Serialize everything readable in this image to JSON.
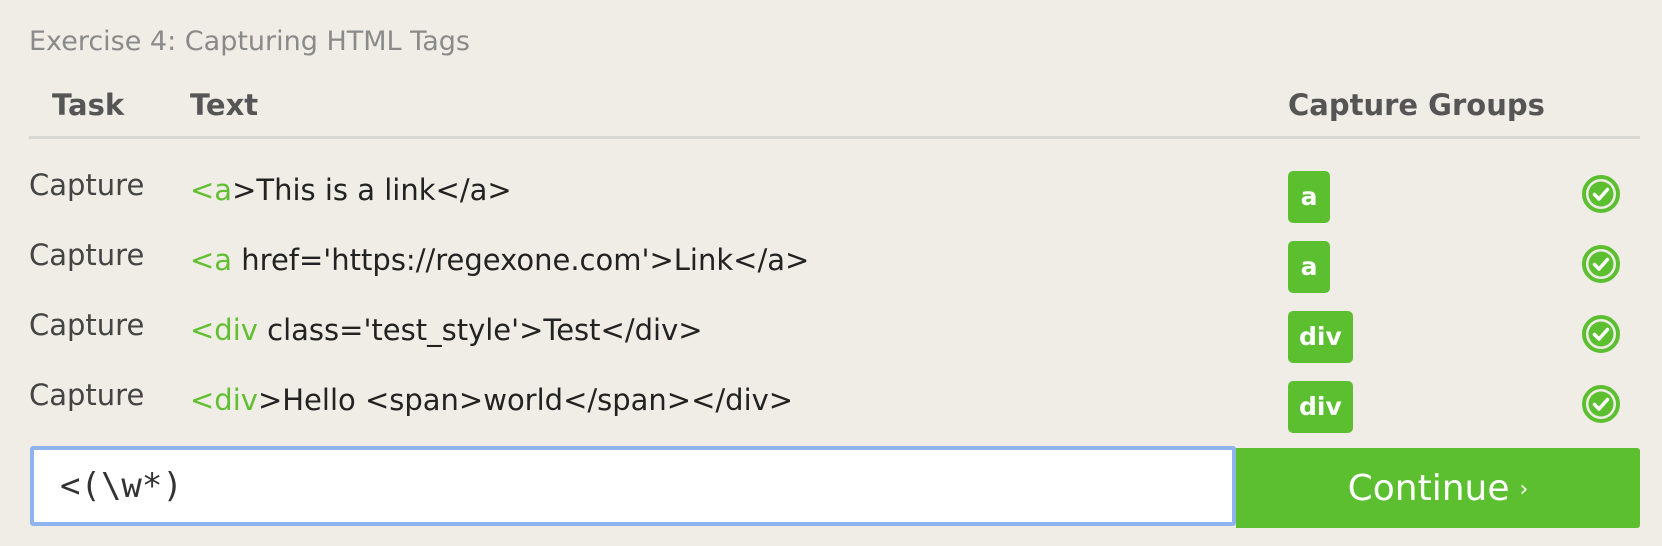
{
  "exercise": {
    "title": "Exercise 4: Capturing HTML Tags"
  },
  "table": {
    "headers": {
      "task": "Task",
      "text": "Text",
      "capture_groups": "Capture Groups"
    },
    "rows": [
      {
        "task": "Capture",
        "text_highlight": "<a",
        "text_rest": ">This is a link</a>",
        "group": "a",
        "status": "check-circle-icon"
      },
      {
        "task": "Capture",
        "text_highlight": "<a",
        "text_rest": " href='https://regexone.com'>Link</a>",
        "group": "a",
        "status": "check-circle-icon"
      },
      {
        "task": "Capture",
        "text_highlight": "<div",
        "text_rest": " class='test_style'>Test</div>",
        "group": "div",
        "status": "check-circle-icon"
      },
      {
        "task": "Capture",
        "text_highlight": "<div",
        "text_rest": ">Hello <span>world</span></div>",
        "group": "div",
        "status": "check-circle-icon"
      }
    ]
  },
  "regex_input": {
    "value": "<(\\w*)"
  },
  "continue_button": {
    "label": "Continue",
    "chevron": "›"
  },
  "colors": {
    "background": "#efede6",
    "accent_green": "#5cbf30",
    "input_focus_border": "#8fb3ee",
    "header_text": "#555555",
    "title_text": "#8a8a8a"
  }
}
